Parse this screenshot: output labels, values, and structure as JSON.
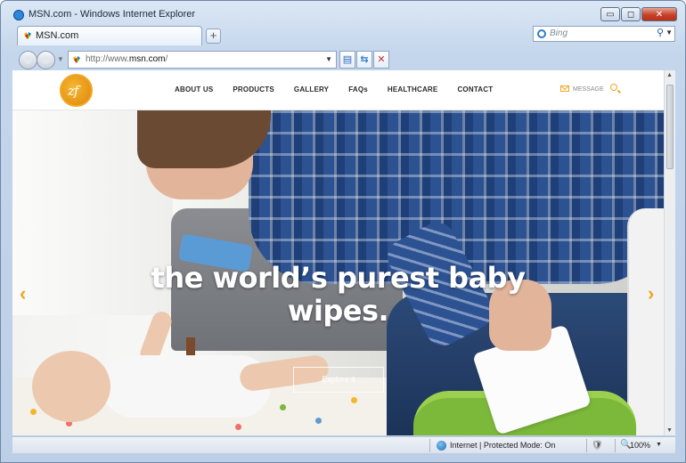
{
  "window": {
    "title": "MSN.com - Windows Internet Explorer",
    "minimize_glyph": "▭",
    "maximize_glyph": "◻",
    "close_glyph": "✕"
  },
  "tabs": [
    {
      "label": "MSN.com"
    }
  ],
  "new_tab_glyph": "+",
  "search": {
    "placeholder": "Bing",
    "go_glyph": "⚲",
    "dropdown_glyph": "▼"
  },
  "address": {
    "prefix": "http://www.",
    "domain": "msn.com",
    "suffix": "/"
  },
  "nav_buttons": {
    "dropdown_glyph": "▼",
    "compat_glyph": "▤",
    "refresh_glyph": "⇆",
    "stop_glyph": "✕"
  },
  "site": {
    "logo_text": "zf",
    "nav": [
      "ABOUT US",
      "PRODUCTS",
      "GALLERY",
      "FAQs",
      "HEALTHCARE",
      "CONTACT"
    ],
    "message_label": "MESSAGE",
    "hero": {
      "headline_line1": "the world’s purest baby",
      "headline_line2": "wipes.",
      "cta": "Explore it",
      "prev_glyph": "‹",
      "next_glyph": "›"
    }
  },
  "statusbar": {
    "zone": "Internet | Protected Mode: On",
    "zoom": "100%",
    "protect_glyph": "🛡",
    "zoom_glyph": "🔍",
    "dropdown_glyph": "▼"
  },
  "scrollbar": {
    "up_glyph": "▲",
    "down_glyph": "▼"
  },
  "colors": {
    "accent": "#f0a51f",
    "titlebar": "#c4d6ec",
    "close_button": "#c6412a"
  }
}
